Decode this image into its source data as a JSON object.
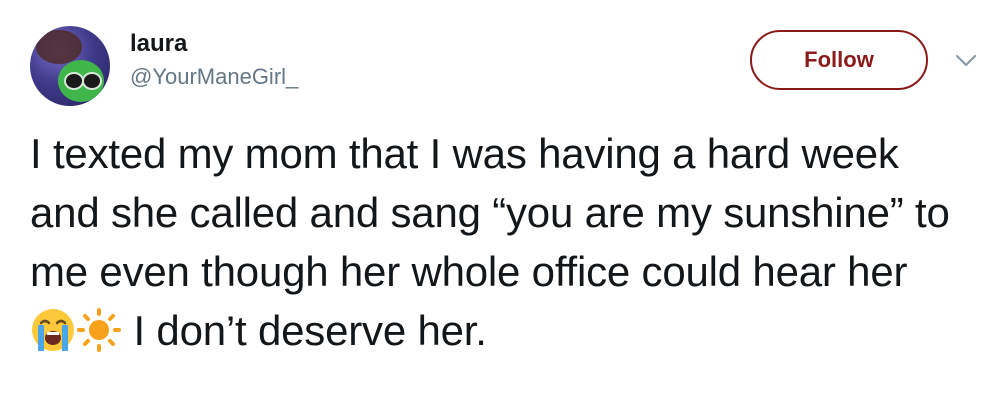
{
  "user": {
    "name": "laura",
    "handle": "@YourManeGirl_"
  },
  "header": {
    "follow_label": "Follow"
  },
  "tweet": {
    "text_before_emoji": "I texted my mom that I was having a hard week and she called and sang “you are my sunshine” to me even though her whole office could hear her ",
    "emojis": [
      "loudly-crying-face",
      "sun"
    ],
    "text_after_emoji": " I don’t deserve her."
  },
  "icons": {
    "menu": "chevron-down-icon",
    "avatar": "avatar"
  },
  "colors": {
    "follow_accent": "#8b1a1a",
    "handle": "#657786",
    "text": "#14171a"
  }
}
